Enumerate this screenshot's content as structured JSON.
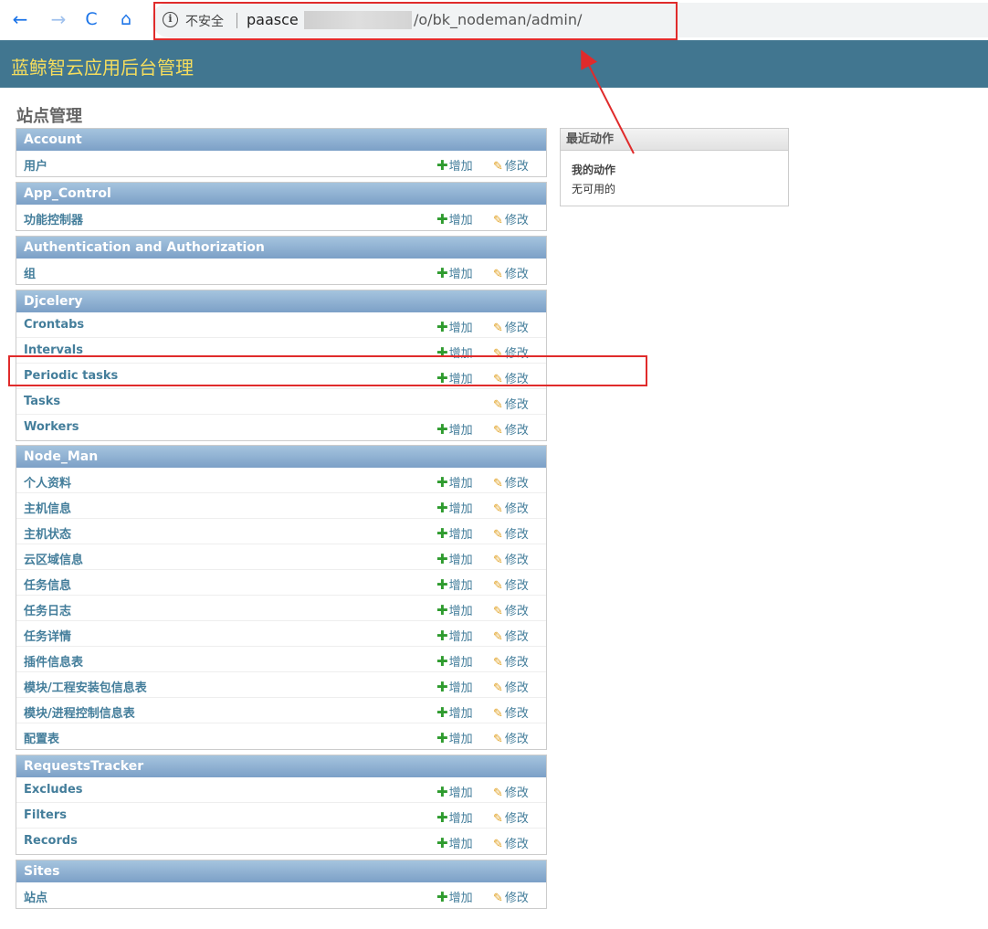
{
  "browser": {
    "back_icon": "←",
    "forward_icon": "→",
    "reload_icon": "C",
    "home_icon": "⌂",
    "info_icon": "i",
    "security_label": "不安全",
    "url_prefix": "paasce",
    "url_suffix": "/o/bk_nodeman/admin/"
  },
  "header": {
    "site_title": "蓝鲸智云应用后台管理"
  },
  "page_title": "站点管理",
  "actions": {
    "add_label": "增加",
    "change_label": "修改",
    "add_icon": "plus-icon",
    "change_icon": "pencil-icon"
  },
  "modules": [
    {
      "caption": "Account",
      "models": [
        {
          "name": "用户",
          "has_add": true
        }
      ]
    },
    {
      "caption": "App_Control",
      "models": [
        {
          "name": "功能控制器",
          "has_add": true
        }
      ]
    },
    {
      "caption": "Authentication and Authorization",
      "models": [
        {
          "name": "组",
          "has_add": true
        }
      ]
    },
    {
      "caption": "Djcelery",
      "models": [
        {
          "name": "Crontabs",
          "has_add": true
        },
        {
          "name": "Intervals",
          "has_add": true
        },
        {
          "name": "Periodic tasks",
          "has_add": true
        },
        {
          "name": "Tasks",
          "has_add": false
        },
        {
          "name": "Workers",
          "has_add": true
        }
      ]
    },
    {
      "caption": "Node_Man",
      "models": [
        {
          "name": "个人资料",
          "has_add": true
        },
        {
          "name": "主机信息",
          "has_add": true
        },
        {
          "name": "主机状态",
          "has_add": true
        },
        {
          "name": "云区域信息",
          "has_add": true
        },
        {
          "name": "任务信息",
          "has_add": true
        },
        {
          "name": "任务日志",
          "has_add": true
        },
        {
          "name": "任务详情",
          "has_add": true
        },
        {
          "name": "插件信息表",
          "has_add": true
        },
        {
          "name": "模块/工程安装包信息表",
          "has_add": true
        },
        {
          "name": "模块/进程控制信息表",
          "has_add": true
        },
        {
          "name": "配置表",
          "has_add": true
        }
      ]
    },
    {
      "caption": "RequestsTracker",
      "models": [
        {
          "name": "Excludes",
          "has_add": true
        },
        {
          "name": "Filters",
          "has_add": true
        },
        {
          "name": "Records",
          "has_add": true
        }
      ]
    },
    {
      "caption": "Sites",
      "models": [
        {
          "name": "站点",
          "has_add": true
        }
      ]
    }
  ],
  "recent_actions": {
    "caption": "最近动作",
    "my_actions_title": "我的动作",
    "empty_text": "无可用的"
  },
  "colors": {
    "header_bg": "#417690",
    "site_title": "#f5dd5d",
    "annotation": "#e02b2b",
    "link": "#447e9b"
  }
}
